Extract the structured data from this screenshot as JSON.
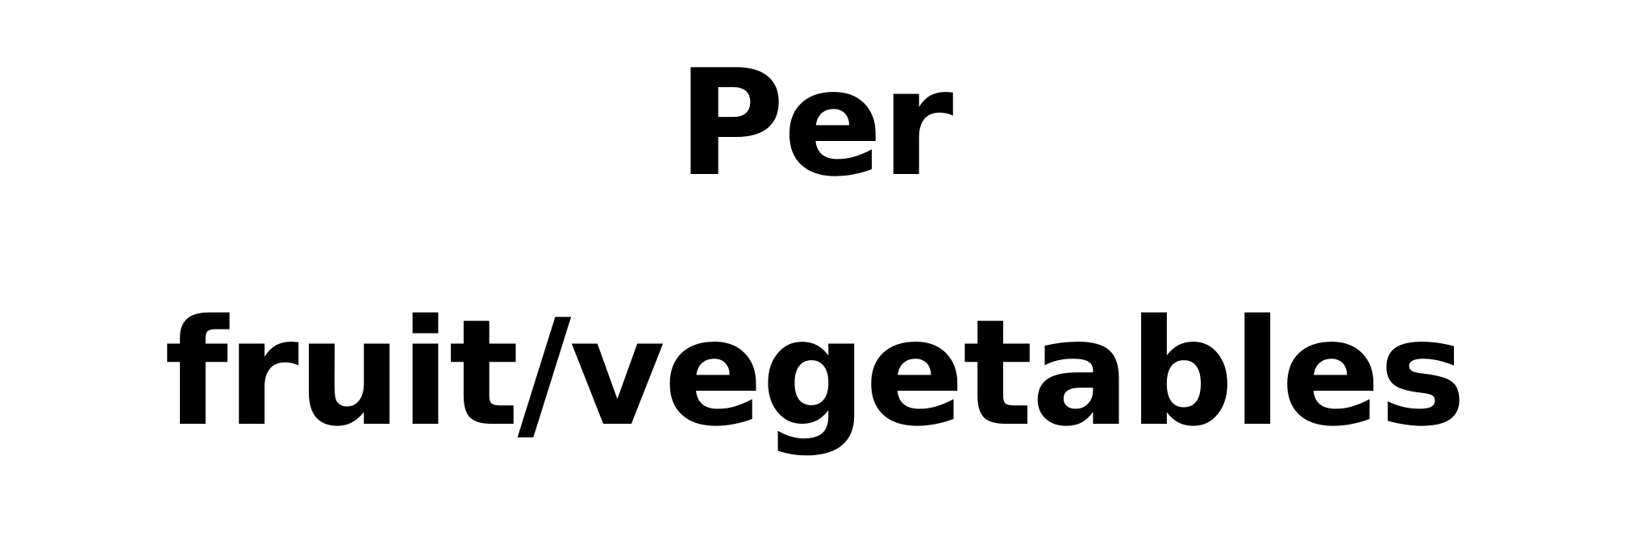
{
  "heading": {
    "line1": "Per",
    "line2": "fruit/vegetables"
  },
  "colors": {
    "text": "#000000",
    "background": "#ffffff"
  }
}
